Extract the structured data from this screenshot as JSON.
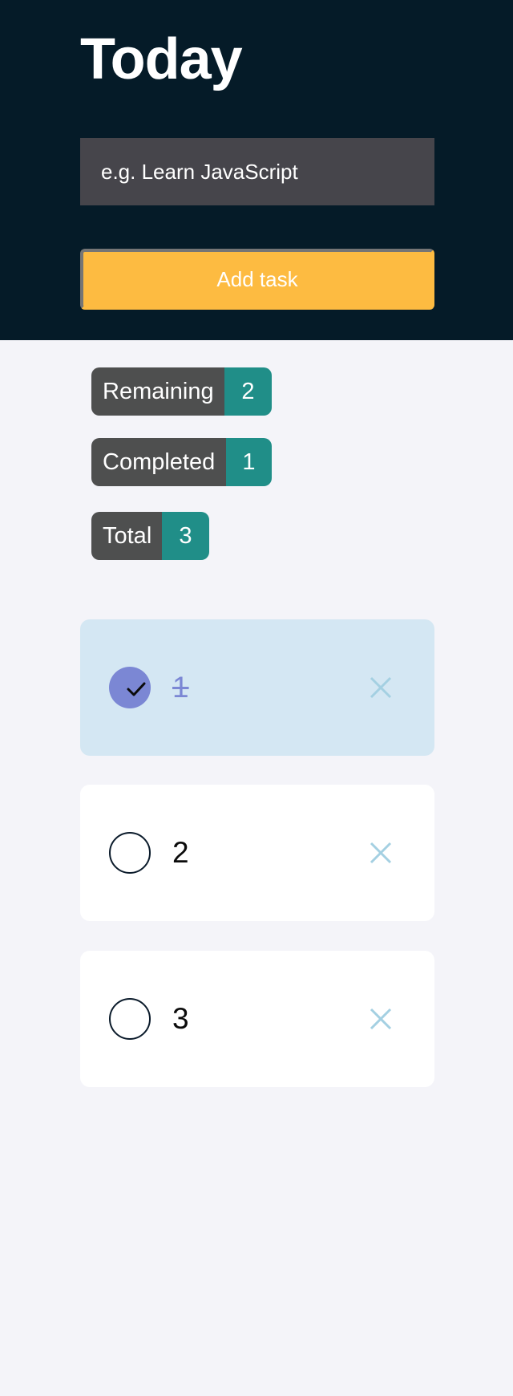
{
  "header": {
    "title": "Today",
    "input": {
      "placeholder": "e.g. Learn JavaScript",
      "value": ""
    },
    "add_button_label": "Add task"
  },
  "stats": {
    "remaining": {
      "label": "Remaining",
      "count": "2"
    },
    "completed": {
      "label": "Completed",
      "count": "1"
    },
    "total": {
      "label": "Total",
      "count": "3"
    }
  },
  "tasks": [
    {
      "text": "1",
      "completed": true
    },
    {
      "text": "2",
      "completed": false
    },
    {
      "text": "3",
      "completed": false
    }
  ],
  "icons": {
    "check": "checkmark-icon",
    "delete": "close-icon"
  },
  "colors": {
    "header_bg": "#051b28",
    "accent": "#fdbb41",
    "badge_label": "#4e4f4f",
    "badge_count": "#208e88",
    "completed_card": "#d4e7f3",
    "completed_check": "#7b87d4",
    "delete_icon": "#a4d0e2"
  }
}
